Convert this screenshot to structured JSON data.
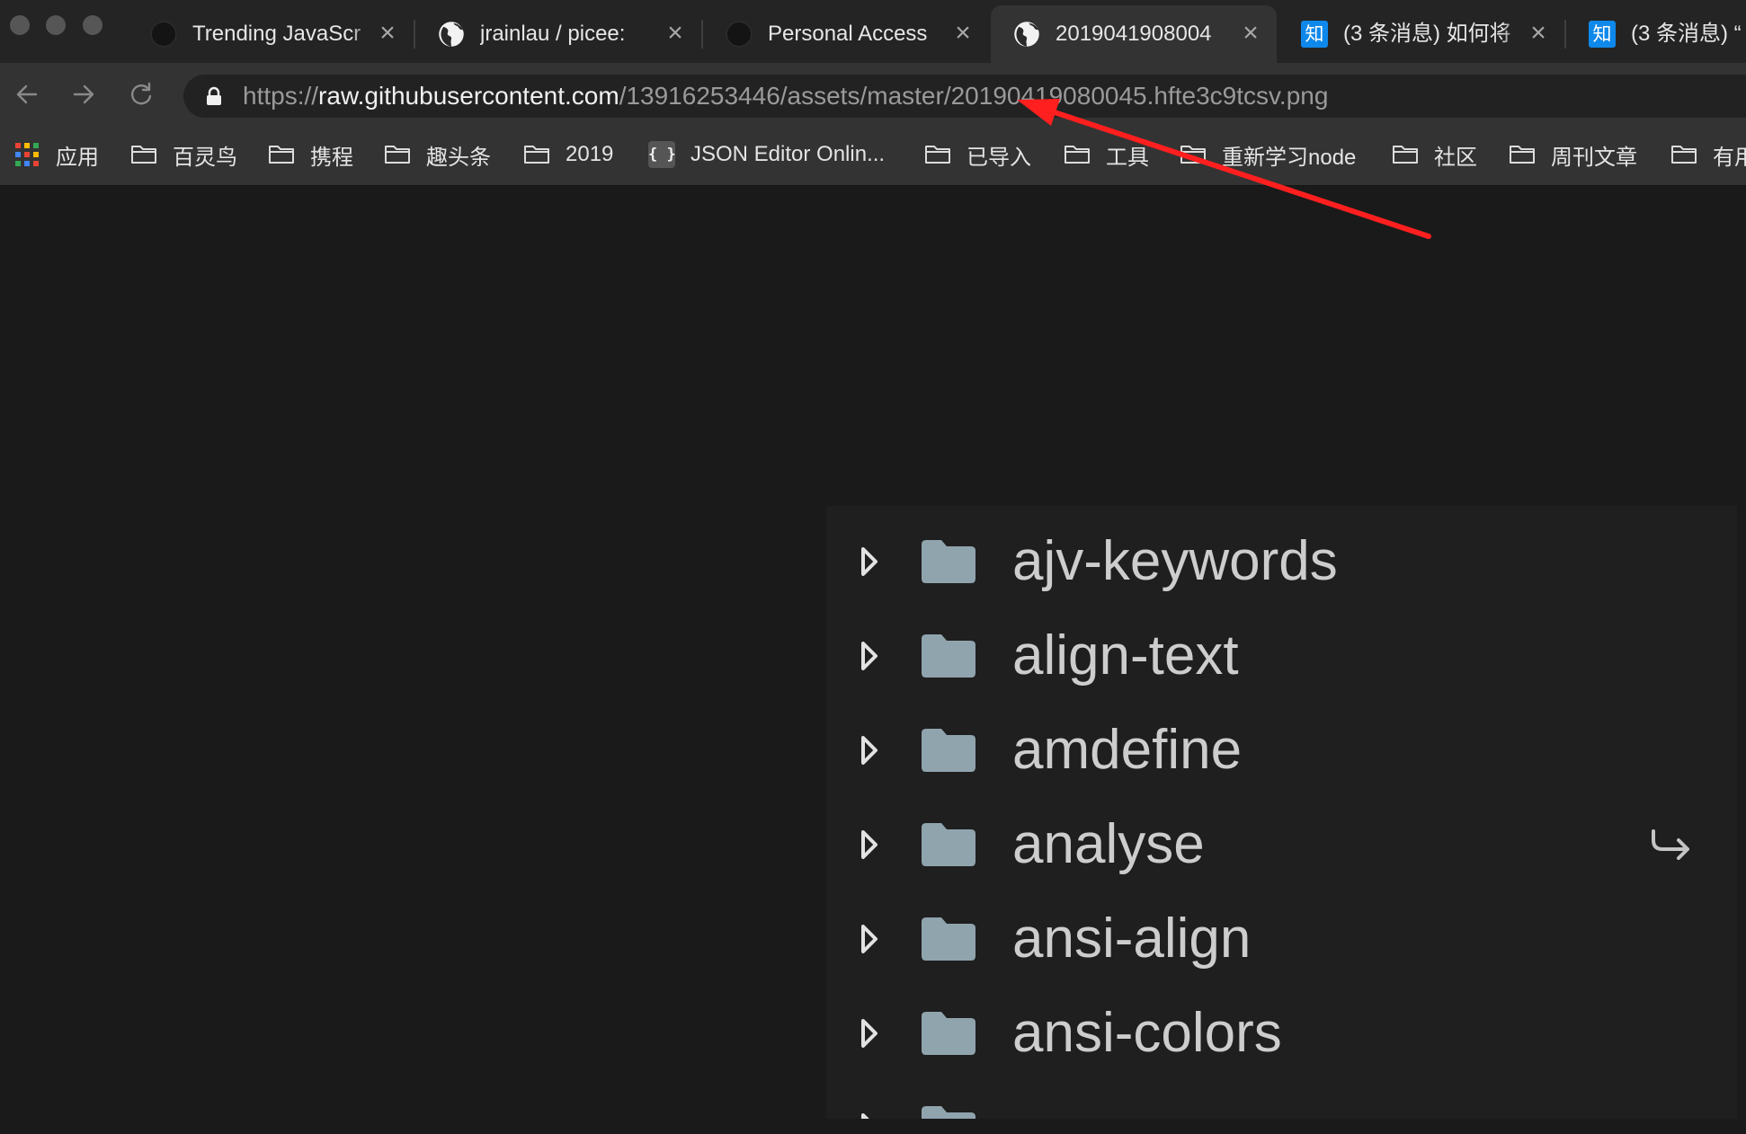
{
  "tabs": [
    {
      "title": "Trending JavaScr",
      "icon": "github-icon",
      "close": "×",
      "active": false
    },
    {
      "title": "jrainlau / picee:",
      "icon": "globe-icon",
      "close": "×",
      "active": false
    },
    {
      "title": "Personal Access",
      "icon": "github-icon",
      "close": "×",
      "active": false
    },
    {
      "title": "2019041908004",
      "icon": "globe-icon",
      "close": "×",
      "active": true
    },
    {
      "title": "(3 条消息) 如何将",
      "icon": "zhihu-icon",
      "icon_glyph": "知",
      "close": "×",
      "active": false
    },
    {
      "title": "(3 条消息) “",
      "icon": "zhihu-icon",
      "icon_glyph": "知",
      "active": false
    }
  ],
  "nav": {
    "back_icon": "back-arrow-icon",
    "forward_icon": "forward-arrow-icon",
    "reload_icon": "reload-icon"
  },
  "address_bar": {
    "secure_icon": "lock-icon",
    "scheme": "https://",
    "host": "raw.githubusercontent.com",
    "path": "/13916253446/assets/master/20190419080045.hfte3c9tcsv.png"
  },
  "bookmarks": {
    "apps": {
      "label": "应用",
      "icon": "apps-grid-icon"
    },
    "items": [
      {
        "label": "百灵鸟",
        "icon": "folder-icon"
      },
      {
        "label": "携程",
        "icon": "folder-icon"
      },
      {
        "label": "趣头条",
        "icon": "folder-icon"
      },
      {
        "label": "2019",
        "icon": "folder-icon"
      },
      {
        "label": "JSON Editor Onlin...",
        "icon": "json-editor-icon",
        "icon_text": "{ }"
      },
      {
        "label": "已导入",
        "icon": "folder-icon"
      },
      {
        "label": "工具",
        "icon": "folder-icon"
      },
      {
        "label": "重新学习node",
        "icon": "folder-icon"
      },
      {
        "label": "社区",
        "icon": "folder-icon"
      },
      {
        "label": "周刊文章",
        "icon": "folder-icon"
      },
      {
        "label": "有用",
        "icon": "folder-icon"
      }
    ]
  },
  "file_tree": {
    "items": [
      {
        "name": "ajv-keywords",
        "icon": "folder-icon"
      },
      {
        "name": "align-text",
        "icon": "folder-icon"
      },
      {
        "name": "amdefine",
        "icon": "folder-icon"
      },
      {
        "name": "analyse",
        "icon": "folder-icon"
      },
      {
        "name": "ansi-align",
        "icon": "folder-icon"
      },
      {
        "name": "ansi-colors",
        "icon": "folder-icon"
      }
    ],
    "row_action_icon": "return-arrow-icon"
  },
  "colors": {
    "folder": "#90a4ae",
    "zhihu_brand": "#0f88eb",
    "annotation": "#ff1f1f"
  }
}
